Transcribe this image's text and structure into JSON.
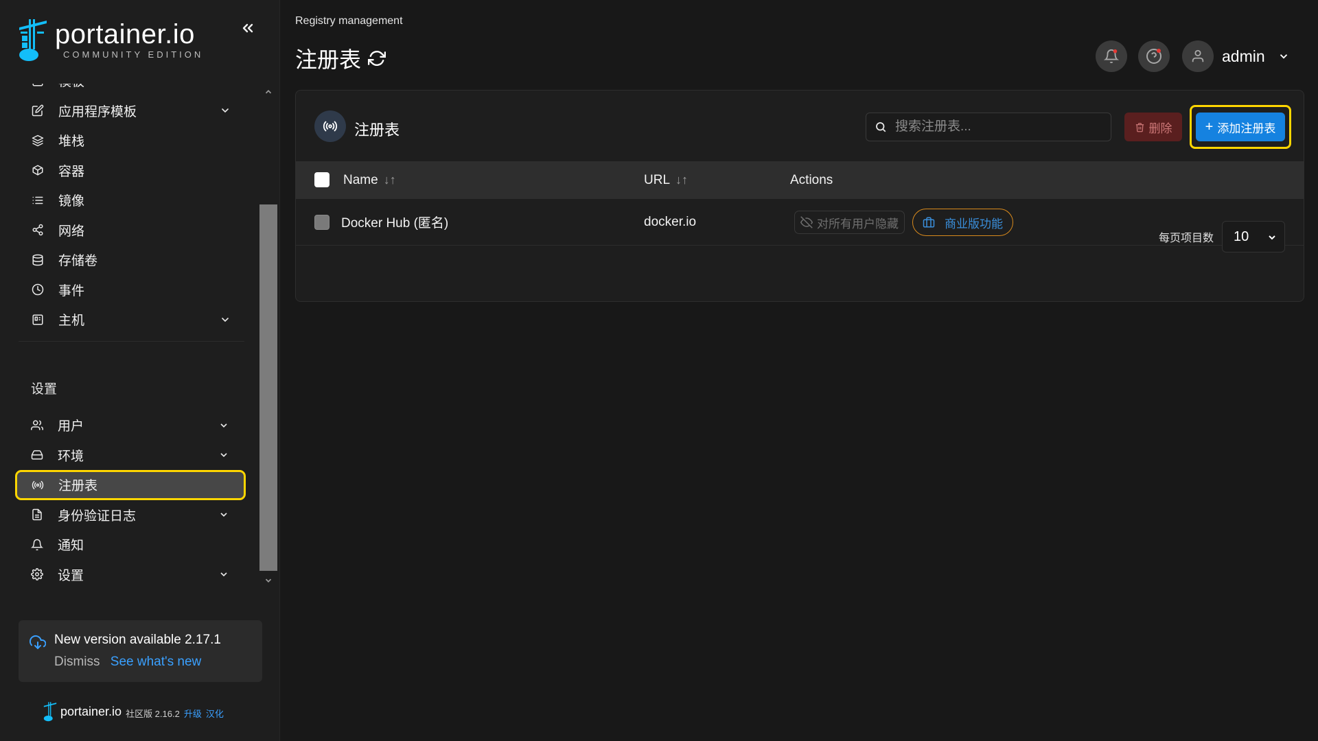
{
  "app": {
    "logo_name": "portainer.io",
    "logo_edition": "COMMUNITY EDITION",
    "accent": "#1582e0",
    "highlight": "#ffd600"
  },
  "sidebar": {
    "partial_item": "模板",
    "items": [
      {
        "label": "应用程序模板",
        "icon": "edit-icon",
        "chevron": true
      },
      {
        "label": "堆栈",
        "icon": "layers-icon",
        "chevron": false
      },
      {
        "label": "容器",
        "icon": "box-icon",
        "chevron": false
      },
      {
        "label": "镜像",
        "icon": "list-icon",
        "chevron": false
      },
      {
        "label": "网络",
        "icon": "share-icon",
        "chevron": false
      },
      {
        "label": "存储卷",
        "icon": "database-icon",
        "chevron": false
      },
      {
        "label": "事件",
        "icon": "clock-icon",
        "chevron": false
      },
      {
        "label": "主机",
        "icon": "host-icon",
        "chevron": true
      }
    ],
    "settings_title": "设置",
    "settings_items": [
      {
        "label": "用户",
        "icon": "users-icon",
        "chevron": true
      },
      {
        "label": "环境",
        "icon": "hard-drive-icon",
        "chevron": true
      },
      {
        "label": "注册表",
        "icon": "radio-icon",
        "chevron": false,
        "active": true
      },
      {
        "label": "身份验证日志",
        "icon": "file-text-icon",
        "chevron": true
      },
      {
        "label": "通知",
        "icon": "bell-icon",
        "chevron": false
      },
      {
        "label": "设置",
        "icon": "gear-icon",
        "chevron": true
      }
    ],
    "update": {
      "title": "New version available 2.17.1",
      "dismiss": "Dismiss",
      "whats_new": "See what's new"
    },
    "footer": {
      "name": "portainer.io",
      "edition": "社区版 2.16.2",
      "upgrade": "升级",
      "localized": "汉化"
    }
  },
  "header": {
    "breadcrumb": "Registry management",
    "title": "注册表",
    "username": "admin"
  },
  "card": {
    "title": "注册表",
    "search_placeholder": "搜索注册表...",
    "delete_label": "删除",
    "add_label": "添加注册表",
    "columns": {
      "name": "Name",
      "url": "URL",
      "actions": "Actions"
    },
    "rows": [
      {
        "name": "Docker Hub (匿名)",
        "url": "docker.io",
        "hide_label": "对所有用户隐藏",
        "business_label": "商业版功能"
      }
    ],
    "per_page_label": "每页项目数",
    "per_page_value": "10"
  }
}
